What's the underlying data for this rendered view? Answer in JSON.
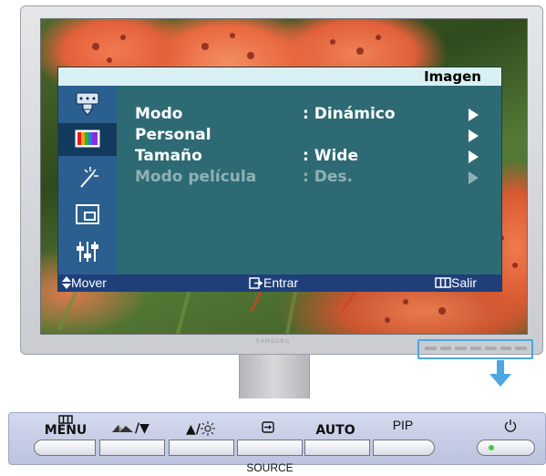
{
  "osd": {
    "title": "Imagen",
    "icons": [
      "input-icon",
      "picture-icon",
      "effect-icon",
      "size-position-icon",
      "setup-icon"
    ],
    "selected_icon": "picture-icon",
    "items": [
      {
        "label": "Modo",
        "value": ": Dinámico",
        "enabled": true
      },
      {
        "label": "Personal",
        "value": "",
        "enabled": true
      },
      {
        "label": "Tamaño",
        "value": ": Wide",
        "enabled": true
      },
      {
        "label": "Modo película",
        "value": ": Des.",
        "enabled": false
      }
    ],
    "footer": {
      "move": "Mover",
      "enter": "Entrar",
      "exit": "Salir"
    },
    "colors": {
      "panel": "#2e6a74",
      "title_bar": "#d9f1f4",
      "icon_column": "#2b5f8f",
      "footer": "#1f3f7a"
    }
  },
  "monitor": {
    "brand": "SAMSUNG",
    "highlight_color": "#4ba6e1"
  },
  "button_panel": {
    "buttons": [
      {
        "label": "MENU",
        "icon": "menu-icon"
      },
      {
        "label": "/▼",
        "icon": "brightness-icon"
      },
      {
        "label": "▲/",
        "icon": "sun-icon"
      },
      {
        "label": "",
        "icon": "source-icon"
      },
      {
        "label": "AUTO",
        "icon": ""
      },
      {
        "label": "PIP",
        "icon": ""
      },
      {
        "label": "",
        "icon": "power-icon"
      }
    ],
    "source_label": "SOURCE"
  }
}
